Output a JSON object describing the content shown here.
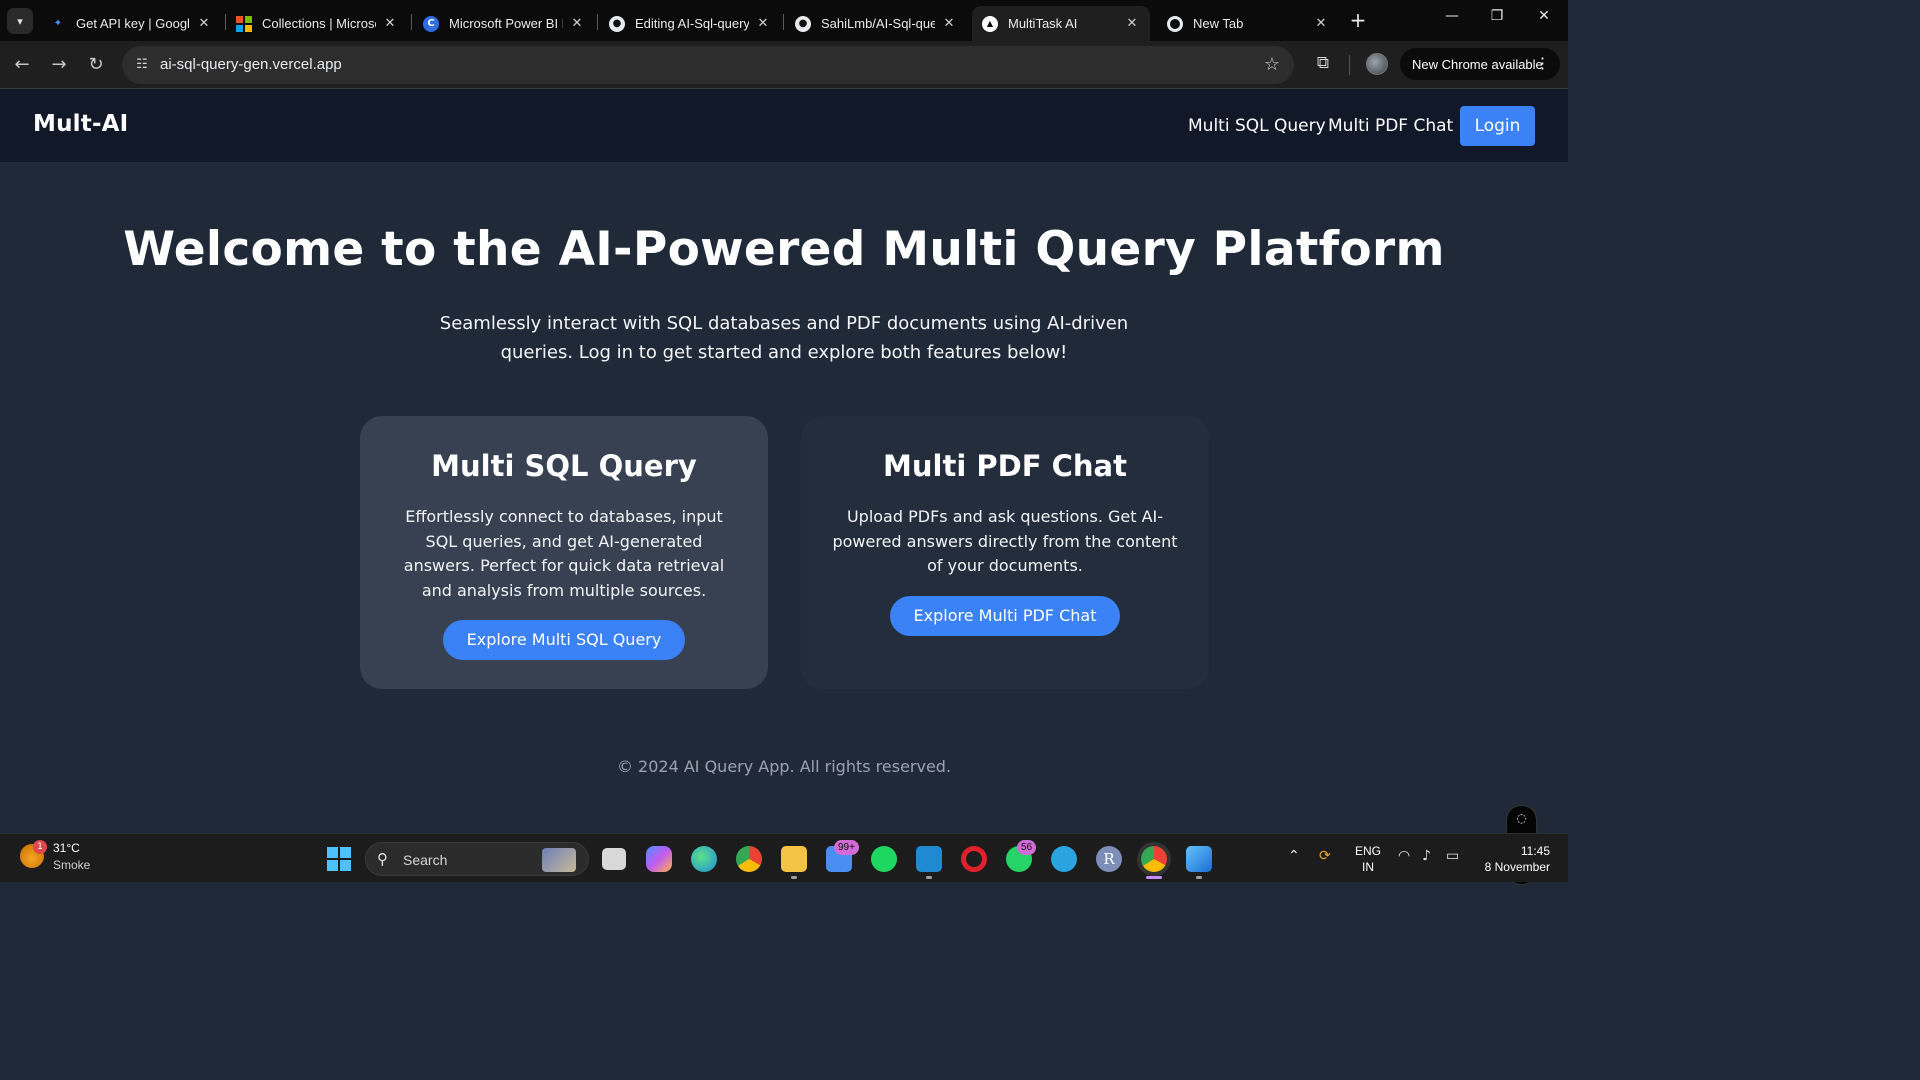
{
  "browser": {
    "tabs": [
      {
        "title": "Get API key | Google",
        "icon": "google-ai-studio-icon"
      },
      {
        "title": "Collections | Microsof",
        "icon": "microsoft-logo-icon"
      },
      {
        "title": "Microsoft Power BI D",
        "icon": "power-bi-c-icon"
      },
      {
        "title": "Editing AI-Sql-query-",
        "icon": "github-icon"
      },
      {
        "title": "SahiLmb/AI-Sql-quer",
        "icon": "github-icon"
      },
      {
        "title": "MultiTask AI",
        "icon": "vercel-triangle-icon"
      },
      {
        "title": "New Tab",
        "icon": "chrome-icon"
      }
    ],
    "address": {
      "url": "ai-sql-query-gen.vercel.app"
    },
    "update_label": "New Chrome available"
  },
  "site": {
    "brand": "Mult-AI",
    "nav": {
      "sql": "Multi SQL Query",
      "pdf": "Multi PDF Chat",
      "login": "Login"
    },
    "hero": {
      "title": "Welcome to the AI-Powered Multi Query Platform",
      "subtitle": "Seamlessly interact with SQL databases and PDF documents using AI-driven queries. Log in to get started and explore both features below!"
    },
    "cards": {
      "sql": {
        "title": "Multi SQL Query",
        "body": "Effortlessly connect to databases, input SQL queries, and get AI-generated answers. Perfect for quick data retrieval and analysis from multiple sources.",
        "cta": "Explore Multi SQL Query"
      },
      "pdf": {
        "title": "Multi PDF Chat",
        "body": "Upload PDFs and ask questions. Get AI-powered answers directly from the content of your documents.",
        "cta": "Explore Multi PDF Chat"
      }
    },
    "footer": "© 2024 AI Query App. All rights reserved.",
    "colors": {
      "accent": "#3b82f6",
      "nav_bg": "#111827",
      "page_bg": "#1f2937"
    }
  },
  "taskbar": {
    "weather": {
      "badge": "1",
      "temp": "31°C",
      "condition": "Smoke"
    },
    "search_placeholder": "Search",
    "mail_badge": "99+",
    "whatsapp_badge": "56",
    "r_app_label": "R",
    "language": {
      "line1": "ENG",
      "line2": "IN"
    },
    "clock": {
      "time": "11:45",
      "date": "8 November"
    }
  }
}
